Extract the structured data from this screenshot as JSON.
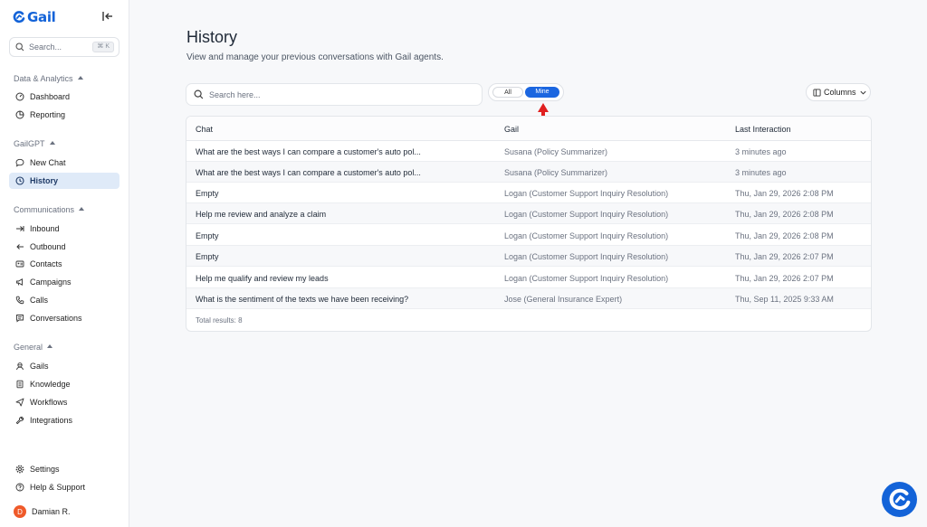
{
  "brand": {
    "name": "Gail",
    "color": "#1363d8"
  },
  "sidebar": {
    "search_placeholder": "Search...",
    "search_shortcut": "⌘ K",
    "sections": [
      {
        "label": "Data & Analytics",
        "items": [
          {
            "label": "Dashboard",
            "icon": "gauge-icon"
          },
          {
            "label": "Reporting",
            "icon": "chart-pie-icon"
          }
        ]
      },
      {
        "label": "GailGPT",
        "items": [
          {
            "label": "New Chat",
            "icon": "chat-bubble-icon"
          },
          {
            "label": "History",
            "icon": "clock-icon",
            "active": true
          }
        ]
      },
      {
        "label": "Communications",
        "items": [
          {
            "label": "Inbound",
            "icon": "arrow-in-icon"
          },
          {
            "label": "Outbound",
            "icon": "arrow-out-icon"
          },
          {
            "label": "Contacts",
            "icon": "id-card-icon"
          },
          {
            "label": "Campaigns",
            "icon": "megaphone-icon"
          },
          {
            "label": "Calls",
            "icon": "phone-icon"
          },
          {
            "label": "Conversations",
            "icon": "chat-square-icon"
          }
        ]
      },
      {
        "label": "General",
        "items": [
          {
            "label": "Gails",
            "icon": "agent-icon"
          },
          {
            "label": "Knowledge",
            "icon": "book-icon"
          },
          {
            "label": "Workflows",
            "icon": "send-icon"
          },
          {
            "label": "Integrations",
            "icon": "wrench-icon"
          }
        ]
      }
    ],
    "footer": [
      {
        "label": "Settings",
        "icon": "gear-icon"
      },
      {
        "label": "Help & Support",
        "icon": "help-circle-icon"
      }
    ],
    "user": {
      "initial": "D",
      "name": "Damian R.",
      "color": "#ef5a2a"
    }
  },
  "page": {
    "title": "History",
    "subtitle": "View and manage your previous conversations with Gail agents."
  },
  "filters": {
    "search_placeholder": "Search here...",
    "toggle": {
      "all_label": "All",
      "mine_label": "Mine",
      "selected": "Mine"
    },
    "columns_label": "Columns"
  },
  "table": {
    "headers": {
      "chat": "Chat",
      "gail": "Gail",
      "last": "Last Interaction"
    },
    "rows": [
      {
        "chat": "What are the best ways I can compare a customer's auto pol...",
        "gail": "Susana (Policy Summarizer)",
        "last": "3 minutes ago"
      },
      {
        "chat": "What are the best ways I can compare a customer's auto pol...",
        "gail": "Susana (Policy Summarizer)",
        "last": "3 minutes ago"
      },
      {
        "chat": "Empty",
        "gail": "Logan (Customer Support Inquiry Resolution)",
        "last": "Thu, Jan 29, 2026 2:08 PM"
      },
      {
        "chat": "Help me review and analyze a claim",
        "gail": "Logan (Customer Support Inquiry Resolution)",
        "last": "Thu, Jan 29, 2026 2:08 PM"
      },
      {
        "chat": "Empty",
        "gail": "Logan (Customer Support Inquiry Resolution)",
        "last": "Thu, Jan 29, 2026 2:08 PM"
      },
      {
        "chat": "Empty",
        "gail": "Logan (Customer Support Inquiry Resolution)",
        "last": "Thu, Jan 29, 2026 2:07 PM"
      },
      {
        "chat": "Help me qualify and review my leads",
        "gail": "Logan (Customer Support Inquiry Resolution)",
        "last": "Thu, Jan 29, 2026 2:07 PM"
      },
      {
        "chat": "What is the sentiment of the texts we have been receiving?",
        "gail": "Jose (General Insurance Expert)",
        "last": "Thu, Sep 11, 2025 9:33 AM"
      }
    ],
    "total_label": "Total results: 8"
  },
  "annotation": {
    "arrow_color": "#e02020"
  }
}
